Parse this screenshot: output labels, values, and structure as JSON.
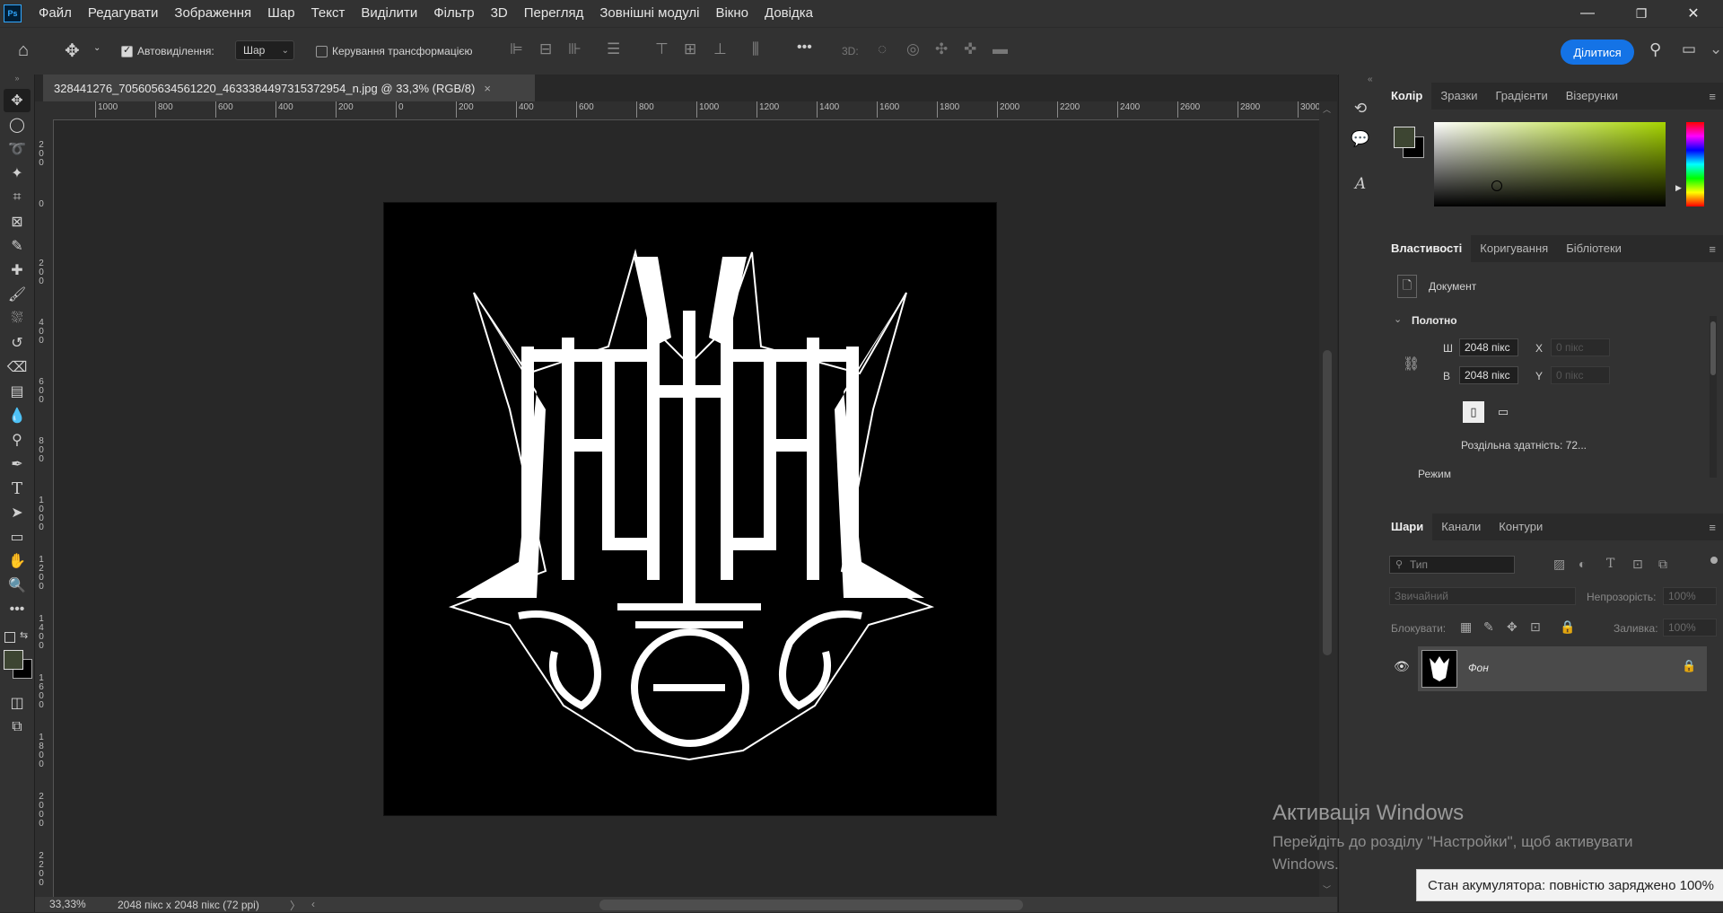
{
  "app": {
    "name": "Photoshop",
    "logo_text": "Ps"
  },
  "menu": [
    "Файл",
    "Редагувати",
    "Зображення",
    "Шар",
    "Текст",
    "Виділити",
    "Фільтр",
    "3D",
    "Перегляд",
    "Зовнішні модулі",
    "Вікно",
    "Довідка"
  ],
  "window_controls": {
    "minimize": "—",
    "restore": "❐",
    "close": "✕"
  },
  "options": {
    "autoselect_label": "Автовиділення:",
    "autoselect_checked": true,
    "autoselect_target": "Шар",
    "transform_label": "Керування трансформацією",
    "transform_checked": false,
    "mode_3d_label": "3D:",
    "more": "•••",
    "share_label": "Ділитися"
  },
  "document": {
    "tab_title": "328441276_705605634561220_4633384497315372954_n.jpg @ 33,3% (RGB/8)",
    "close": "×",
    "zoom": "33,33%",
    "info": "2048 пікс x 2048 пікс (72 ppi)",
    "info_arrow": "〉"
  },
  "ruler": {
    "h_labels": [
      "1000",
      "800",
      "600",
      "400",
      "200",
      "0",
      "200",
      "400",
      "600",
      "800",
      "1000",
      "1200",
      "1400",
      "1600",
      "1800",
      "2000",
      "2200",
      "2400",
      "2600",
      "2800",
      "3000"
    ],
    "v_labels": [
      "2\n0\n0",
      "0",
      "2\n0\n0",
      "4\n0\n0",
      "6\n0\n0",
      "8\n0\n0",
      "1\n0\n0\n0",
      "1\n2\n0\n0",
      "1\n4\n0\n0",
      "1\n6\n0\n0",
      "1\n8\n0\n0",
      "2\n0\n0\n0",
      "2\n2\n0\n0"
    ]
  },
  "color_panel": {
    "tabs": [
      "Колір",
      "Зразки",
      "Градієнти",
      "Візерунки"
    ],
    "active": 0,
    "foreground": "#3d4532",
    "background": "#000000",
    "hue_color": "#a6d400"
  },
  "properties_panel": {
    "tabs": [
      "Властивості",
      "Коригування",
      "Бібліотеки"
    ],
    "active": 0,
    "doc_label": "Документ",
    "section": "Полотно",
    "w_label": "Ш",
    "w_value": "2048 пікс",
    "h_label": "В",
    "h_value": "2048 пікс",
    "x_label": "X",
    "x_value": "0 пікс",
    "y_label": "Y",
    "y_value": "0 пікс",
    "resolution": "Роздільна здатність: 72...",
    "mode_label": "Режим"
  },
  "layers_panel": {
    "tabs": [
      "Шари",
      "Канали",
      "Контури"
    ],
    "active": 0,
    "search_placeholder": "Тип",
    "blend_mode": "Звичайний",
    "opacity_label": "Непрозорість:",
    "opacity_value": "100%",
    "lock_label": "Блокувати:",
    "fill_label": "Заливка:",
    "fill_value": "100%",
    "layers": [
      {
        "name": "Фон",
        "visible": true,
        "locked": true
      }
    ]
  },
  "windows_watermark": {
    "title": "Активація Windows",
    "line": "Перейдіть до розділу \"Настройки\", щоб активувати Windows."
  },
  "battery_toast": "Стан акумулятора: повністю заряджено 100%",
  "colors": {
    "accent": "#1473e6"
  }
}
